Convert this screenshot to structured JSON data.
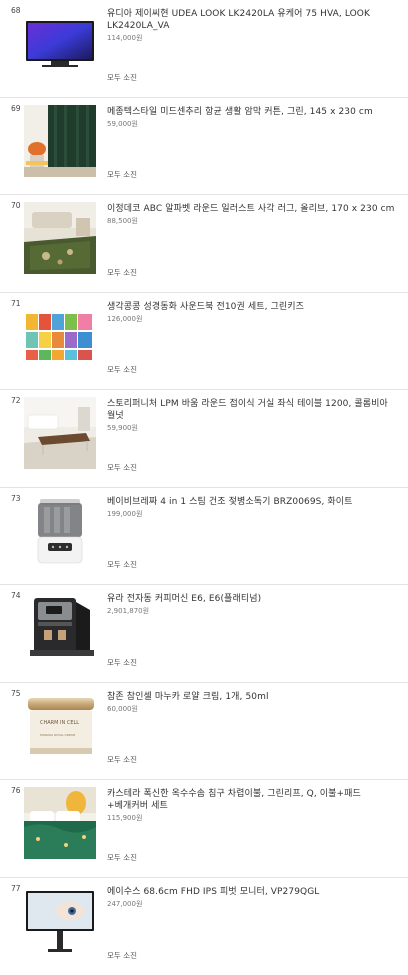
{
  "products": [
    {
      "rank": "68",
      "title": "유디아 제이씨현 UDEA LOOK LK2420LA 유케어 75 HVA, LOOK LK2420LA_VA",
      "price": "114,000원",
      "status": "모두 소진",
      "image": "monitor-image"
    },
    {
      "rank": "69",
      "title": "메종텍스타일 미드센추리 항균 생활 암막 커튼, 그린, 145 x 230 cm",
      "price": "59,000원",
      "status": "모두 소진",
      "image": "curtain-image"
    },
    {
      "rank": "70",
      "title": "이정데코 ABC 알파벳 라운드 일러스트 사각 러그, 올리브, 170 x 230 cm",
      "price": "88,500원",
      "status": "모두 소진",
      "image": "rug-image"
    },
    {
      "rank": "71",
      "title": "생각콩콩 성경동화 사운드북 전10권 세트, 그린키즈",
      "price": "126,000원",
      "status": "모두 소진",
      "image": "books-image"
    },
    {
      "rank": "72",
      "title": "스토리퍼니처 LPM 바움 라운드 접이식 거실 좌식 테이블 1200, 콜롬비아 월넛",
      "price": "59,900원",
      "status": "모두 소진",
      "image": "table-image"
    },
    {
      "rank": "73",
      "title": "베이비브레짜 4 in 1 스팀 건조 젖병소독기 BRZ0069S, 화이트",
      "price": "199,000원",
      "status": "모두 소진",
      "image": "sterilizer-image"
    },
    {
      "rank": "74",
      "title": "유라 전자동 커피머신 E6, E6(플래티넘)",
      "price": "2,901,870원",
      "status": "모두 소진",
      "image": "coffee-machine-image"
    },
    {
      "rank": "75",
      "title": "참존 참인셀 마누카 로얄 크림, 1개, 50ml",
      "price": "60,000원",
      "status": "모두 소진",
      "image": "cream-jar-image"
    },
    {
      "rank": "76",
      "title": "카스테라 폭신한 옥수수솜 침구 차렵이불, 그린리프, Q, 이불+패드+베개커버 세트",
      "price": "115,900원",
      "status": "모두 소진",
      "image": "bedding-image"
    },
    {
      "rank": "77",
      "title": "에이수스 68.6cm FHD IPS 피벗 모니터, VP279QGL",
      "price": "247,000원",
      "status": "모두 소진",
      "image": "monitor2-image"
    }
  ],
  "product_images": {
    "jar_label": "CHARM IN CELL",
    "jar_sub": "MANUKA ROYAL CREAM"
  }
}
